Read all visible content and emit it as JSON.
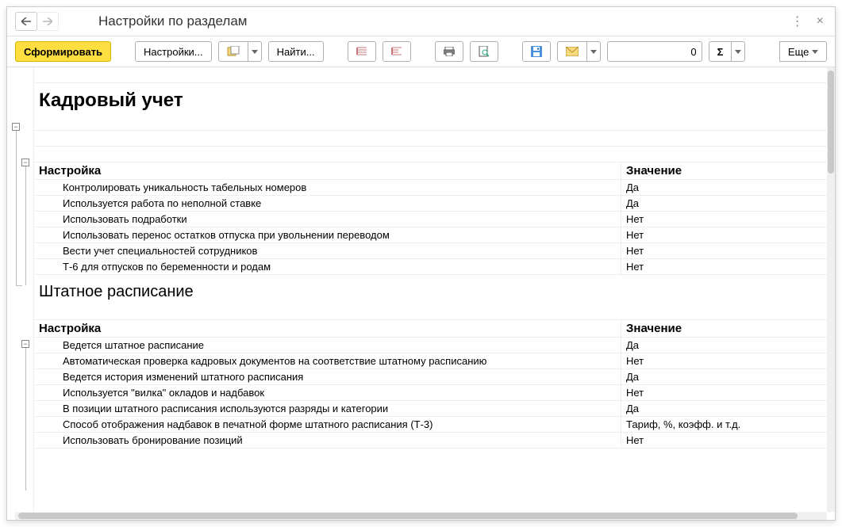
{
  "title": "Настройки по разделам",
  "toolbar": {
    "generate": "Сформировать",
    "settings": "Настройки...",
    "find": "Найти...",
    "more": "Еще",
    "num_value": "0"
  },
  "sections": [
    {
      "title": "Кадровый учет",
      "col_setting": "Настройка",
      "col_value": "Значение",
      "rows": [
        {
          "name": "Контролировать уникальность табельных номеров",
          "value": "Да"
        },
        {
          "name": "Используется работа по неполной ставке",
          "value": "Да"
        },
        {
          "name": "Использовать подработки",
          "value": "Нет"
        },
        {
          "name": "Использовать перенос остатков отпуска при увольнении переводом",
          "value": "Нет"
        },
        {
          "name": "Вести учет специальностей сотрудников",
          "value": "Нет"
        },
        {
          "name": "Т-6 для отпусков по беременности и родам",
          "value": "Нет"
        }
      ]
    },
    {
      "title": "Штатное расписание",
      "col_setting": "Настройка",
      "col_value": "Значение",
      "rows": [
        {
          "name": "Ведется штатное расписание",
          "value": "Да"
        },
        {
          "name": "Автоматическая проверка кадровых документов на соответствие штатному расписанию",
          "value": "Нет"
        },
        {
          "name": "Ведется история изменений штатного расписания",
          "value": "Да"
        },
        {
          "name": "Используется \"вилка\" окладов и надбавок",
          "value": "Нет"
        },
        {
          "name": "В позиции штатного расписания используются разряды и категории",
          "value": "Да"
        },
        {
          "name": "Способ отображения надбавок в печатной форме штатного расписания (Т-3)",
          "value": "Тариф, %, коэфф. и т.д."
        },
        {
          "name": "Использовать бронирование позиций",
          "value": "Нет"
        }
      ]
    }
  ]
}
